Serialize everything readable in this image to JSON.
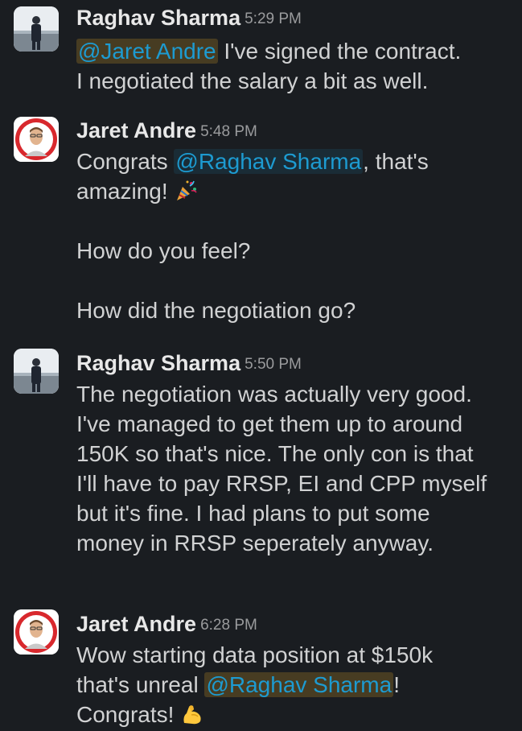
{
  "messages": [
    {
      "author": "Raghav Sharma",
      "time": "5:29 PM",
      "line1_mention": "@Jaret Andre",
      "line1_text": " I've signed the contract.",
      "line2_text": "I negotiated the salary a bit as well."
    },
    {
      "author": "Jaret Andre",
      "time": "5:48 PM",
      "line1_pre": "Congrats ",
      "line1_mention": "@Raghav Sharma",
      "line1_post": ", that's",
      "line2_text": "amazing! ",
      "emoji": "party-popper-icon",
      "para2": "How do you feel?",
      "para3": "How did the negotiation go?"
    },
    {
      "author": "Raghav Sharma",
      "time": "5:50 PM",
      "text": "The negotiation was actually very good. I've managed to get them up to around 150K so that's nice. The only con is that I'll have to pay RRSP, EI and CPP myself but it's fine. I had plans to put some money in RRSP seperately anyway."
    },
    {
      "author": "Jaret Andre",
      "time": "6:28 PM",
      "line1_text": "Wow starting data position at $150k",
      "line2_pre": "that's unreal ",
      "line2_mention": "@Raghav Sharma",
      "line2_post": "!",
      "line3_text": "Congrats! ",
      "emoji": "flexed-biceps-icon"
    }
  ]
}
